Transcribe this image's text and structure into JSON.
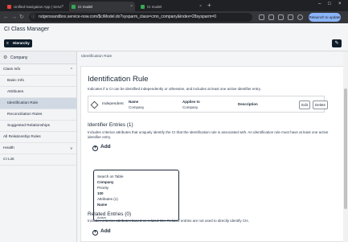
{
  "browser": {
    "tabs": [
      {
        "title": "Unified Navigation App | Servi",
        "active": false,
        "favicon_color": "#e8423c"
      },
      {
        "title": "CI model",
        "active": true,
        "favicon_color": "#34a853"
      },
      {
        "title": "CI model",
        "active": false,
        "favicon_color": "#34a853"
      }
    ],
    "url": "rutgerssandbox.service-now.com/$ciModel.do?sysparm_class=cmn_company&index=28sysparm=0",
    "relaunch_label": "Relaunch to update"
  },
  "app": {
    "title": "CI Class Manager",
    "hierarchy_label": "Hierarchy"
  },
  "sidebar": {
    "class_name": "Company",
    "items": [
      {
        "label": "Class Info",
        "kind": "section",
        "chevron": "up"
      },
      {
        "label": "Basic Info",
        "kind": "sub"
      },
      {
        "label": "Attributes",
        "kind": "sub"
      },
      {
        "label": "Identification Rule",
        "kind": "sub",
        "selected": true
      },
      {
        "label": "Reconciliation Rules",
        "kind": "sub"
      },
      {
        "label": "Suggested Relationships",
        "kind": "sub"
      },
      {
        "label": "All Relationship Rules",
        "kind": "section"
      },
      {
        "label": "Health",
        "kind": "section",
        "chevron": "down"
      },
      {
        "label": "CI List",
        "kind": "section"
      }
    ]
  },
  "main": {
    "breadcrumb": "Identification Rule",
    "title": "Identification Rule",
    "description": "Indicates if a CI can be identified independently or otherwise, and includes at least one active identifier entry.",
    "rule": {
      "type": "Independent",
      "name_label": "Name",
      "name_value": "Company",
      "applies_label": "Applies to",
      "applies_value": "Company",
      "description_label": "Description",
      "edit_label": "Edit",
      "delete_label": "Delete"
    },
    "identifier": {
      "title": "Identifier Entries (1)",
      "description": "Includes criterion attributes that uniquely identify the CI that the identification rule is associated with. An identification rule must have at least one active identifier entry.",
      "add_label": "Add",
      "entry": {
        "search_label": "Search on Table",
        "table": "Company",
        "priority_label": "Priority",
        "priority": "100",
        "attributes_label": "Attributes (1)",
        "attribute": "Name",
        "status": "Active"
      }
    },
    "related": {
      "title": "Related Entries (0)",
      "description": "Includes criterion attributes based on related CIs. Related entries are not used to directly identify CIs.",
      "add_label": "Add"
    }
  }
}
